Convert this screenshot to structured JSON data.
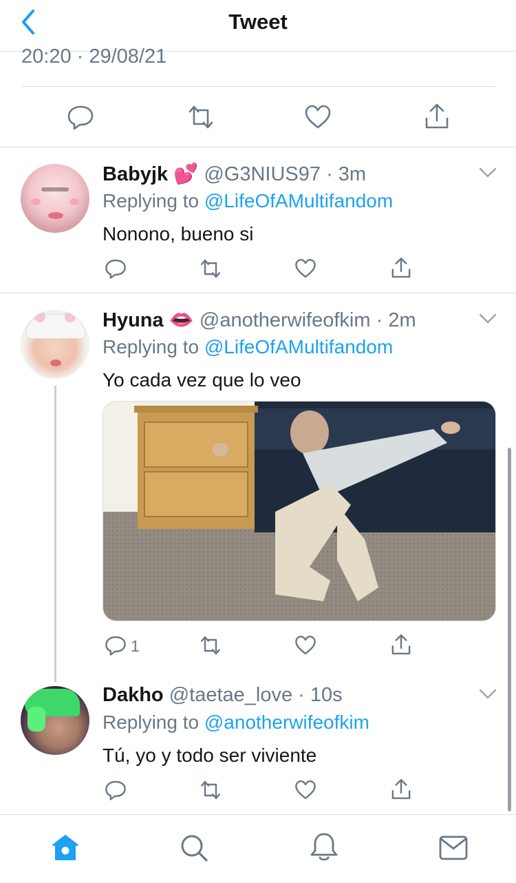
{
  "header": {
    "title": "Tweet"
  },
  "main_tweet": {
    "timestamp": "20:20 · 29/08/21"
  },
  "replies": [
    {
      "name": "Babyjk",
      "emoji": "💕",
      "handle": "@G3NIUS97",
      "time": "3m",
      "replying_prefix": "Replying to ",
      "replying_to": "@LifeOfAMultifandom",
      "text": "Nonono, bueno si"
    },
    {
      "name": "Hyuna",
      "emoji": "👄",
      "handle": "@anotherwifeofkim",
      "time": "2m",
      "replying_prefix": "Replying to ",
      "replying_to": "@LifeOfAMultifandom",
      "text": "Yo cada vez que lo veo",
      "reply_count": "1"
    },
    {
      "name": "Dakho",
      "emoji": "",
      "handle": "@taetae_love",
      "time": "10s",
      "replying_prefix": "Replying to ",
      "replying_to": "@anotherwifeofkim",
      "text": "Tú, yo y todo ser viviente"
    }
  ],
  "icons": {
    "back": "chevron-left-icon",
    "reply": "comment-icon",
    "retweet": "retweet-icon",
    "like": "heart-icon",
    "share": "share-icon",
    "more": "chevron-down-icon",
    "tabs": [
      "home-icon",
      "search-icon",
      "notifications-icon",
      "messages-icon"
    ]
  },
  "colors": {
    "accent": "#1da1f2",
    "muted": "#697886",
    "text": "#14171a",
    "divider": "#d9dee2"
  }
}
